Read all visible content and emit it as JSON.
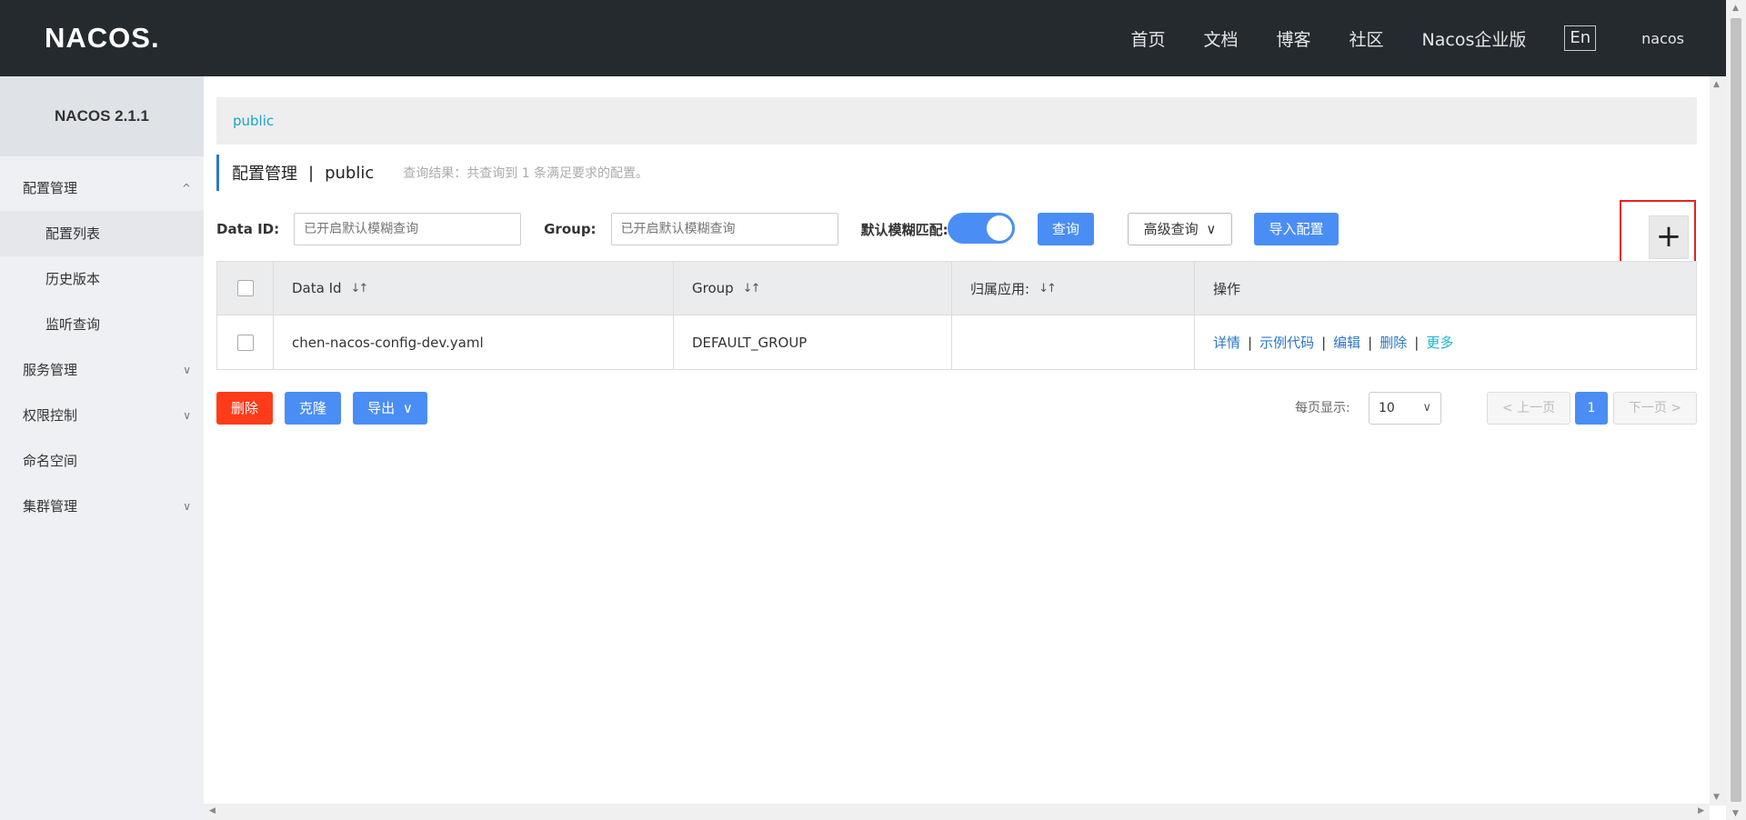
{
  "header": {
    "logo": "NACOS.",
    "nav": [
      "首页",
      "文档",
      "博客",
      "社区",
      "Nacos企业版"
    ],
    "lang": "En",
    "user": "nacos"
  },
  "sidebar": {
    "version": "NACOS 2.1.1",
    "items": [
      {
        "label": "配置管理",
        "chevron": "^"
      },
      {
        "label": "配置列表"
      },
      {
        "label": "历史版本"
      },
      {
        "label": "监听查询"
      },
      {
        "label": "服务管理",
        "chevron": "∨"
      },
      {
        "label": "权限控制",
        "chevron": "∨"
      },
      {
        "label": "命名空间"
      },
      {
        "label": "集群管理",
        "chevron": "∨"
      }
    ]
  },
  "breadcrumb": "public",
  "title": {
    "main": "配置管理",
    "sep": "|",
    "namespace": "public",
    "result": "查询结果：共查询到 1 条满足要求的配置。"
  },
  "filters": {
    "dataid_label": "Data ID:",
    "dataid_placeholder": "已开启默认模糊查询",
    "group_label": "Group:",
    "group_placeholder": "已开启默认模糊查询",
    "fuzzy_label": "默认模糊匹配:",
    "fuzzy_on": true,
    "query_btn": "查询",
    "advanced_btn": "高级查询",
    "import_btn": "导入配置",
    "add_btn": "+"
  },
  "table": {
    "headers": [
      "Data Id",
      "Group",
      "归属应用:",
      "操作"
    ],
    "rows": [
      {
        "dataid": "chen-nacos-config-dev.yaml",
        "group": "DEFAULT_GROUP",
        "app": "",
        "ops": [
          "详情",
          "示例代码",
          "编辑",
          "删除",
          "更多"
        ]
      }
    ]
  },
  "actions": {
    "delete": "删除",
    "clone": "克隆",
    "export": "导出"
  },
  "pagination": {
    "page_size_label": "每页显示:",
    "page_size": "10",
    "prev": "上一页",
    "current": "1",
    "next": "下一页"
  },
  "colors": {
    "header_bg": "#252a2f",
    "primary": "#4a8ef5",
    "danger": "#ff3c1a",
    "link": "#2a78c6",
    "highlight_box": "#e8211d"
  }
}
